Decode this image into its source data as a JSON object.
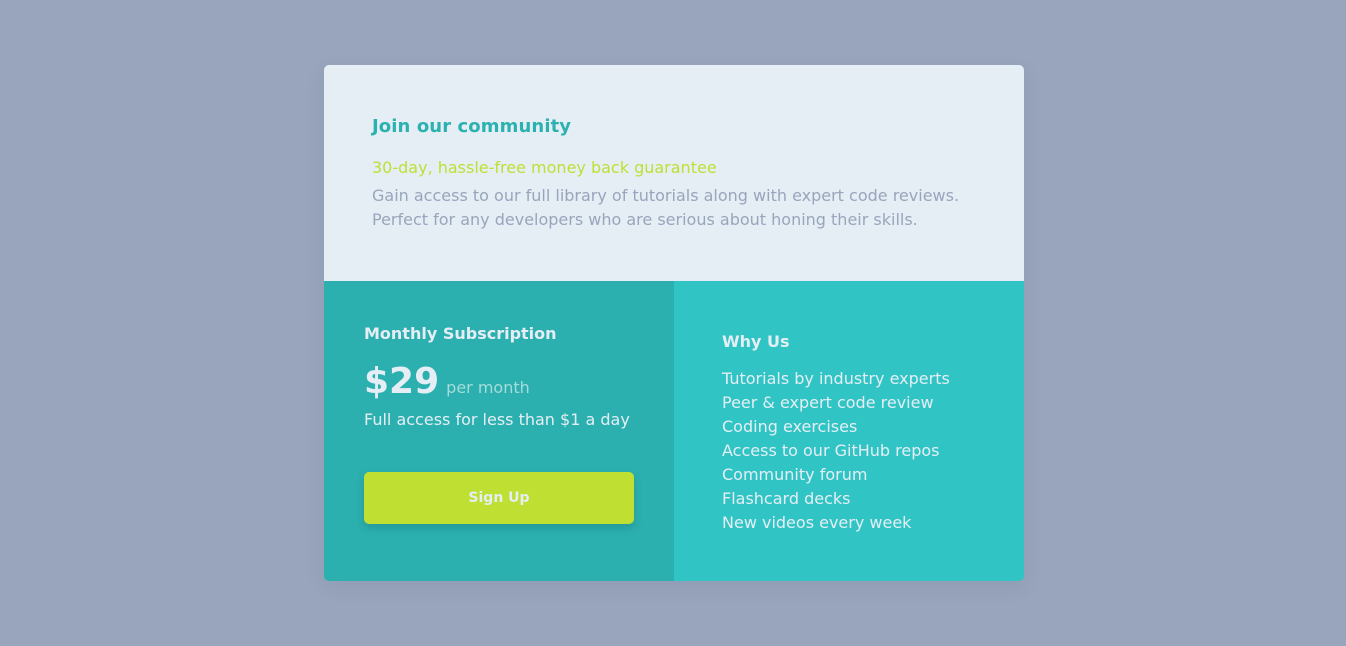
{
  "colors": {
    "page_background": "#98a5bc",
    "card_top": "#e5eef5",
    "card_left": "#2bb0af",
    "card_right": "#30c5c4",
    "accent_teal": "#2bb2b0",
    "accent_lime": "#bfdf32",
    "text_light": "#e5eef5",
    "text_muted": "#98a5bc"
  },
  "header": {
    "title": "Join our community",
    "guarantee": "30-day, hassle-free money back guarantee",
    "description": "Gain access to our full library of tutorials along with expert code reviews. Perfect for any developers who are serious about honing their skills."
  },
  "subscription": {
    "title": "Monthly Subscription",
    "price": "$29",
    "period": "per month",
    "tagline": "Full access for less than $1 a day",
    "button_label": "Sign Up"
  },
  "why_us": {
    "title": "Why Us",
    "items": [
      "Tutorials by industry experts",
      "Peer & expert code review",
      "Coding exercises",
      "Access to our GitHub repos",
      "Community forum",
      "Flashcard decks",
      "New videos every week"
    ]
  }
}
